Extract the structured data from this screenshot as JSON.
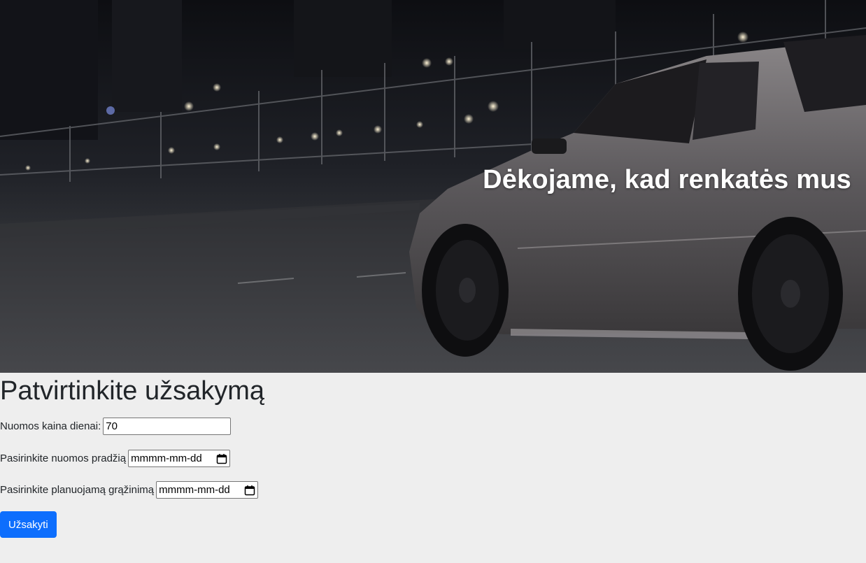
{
  "hero": {
    "title": "Dėkojame, kad renkatės mus"
  },
  "form": {
    "title": "Patvirtinkite užsakymą",
    "price_label": "Nuomos kaina dienai:",
    "price_value": "70",
    "start_label": "Pasirinkite nuomos pradžią",
    "start_value": "mmmm-mm-dd",
    "return_label": "Pasirinkite planuojamą grąžinimą",
    "return_value": "mmmm-mm-dd",
    "submit_label": "Užsakyti"
  },
  "icons": {
    "date_picker": "calendar-icon"
  },
  "colors": {
    "page_background": "#eeeeee",
    "primary_button": "#0d6efd",
    "hero_text": "#ffffff"
  }
}
